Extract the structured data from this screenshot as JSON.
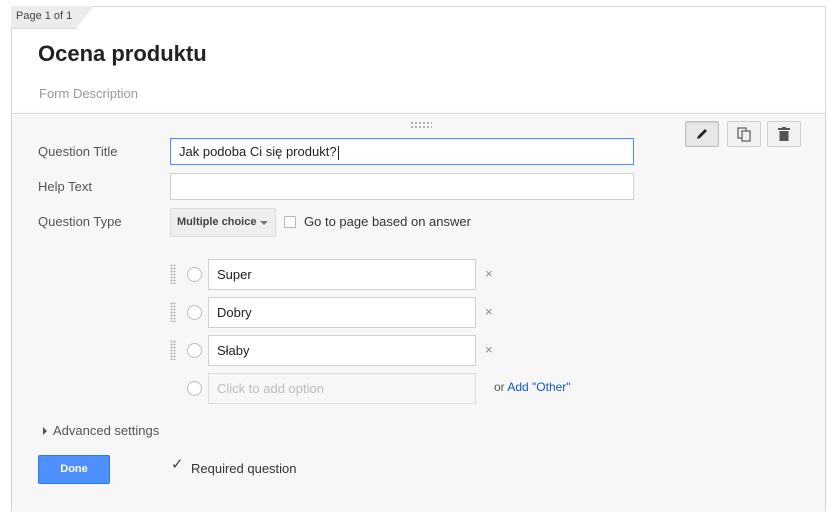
{
  "page_tab": "Page 1 of 1",
  "form": {
    "title": "Ocena produktu",
    "description_placeholder": "Form Description"
  },
  "toolbar": {
    "edit_icon": "pencil-icon",
    "duplicate_icon": "duplicate-icon",
    "delete_icon": "trash-icon"
  },
  "question": {
    "title_label": "Question Title",
    "title_value": "Jak podoba Ci się produkt?",
    "help_label": "Help Text",
    "help_value": "",
    "type_label": "Question Type",
    "type_value": "Multiple choice",
    "go_to_page_label": "Go to page based on answer",
    "go_to_page_checked": false
  },
  "options": [
    {
      "value": "Super",
      "remove": "×"
    },
    {
      "value": "Dobry",
      "remove": "×"
    },
    {
      "value": "Słaby",
      "remove": "×"
    }
  ],
  "add_option_placeholder": "Click to add option",
  "add_other": {
    "prefix": "or",
    "link": "Add \"Other\""
  },
  "advanced_settings": "Advanced settings",
  "done_label": "Done",
  "required_label": "Required question",
  "required_checked": true,
  "colors": {
    "accent": "#4d90fe",
    "link": "#1155cc"
  }
}
